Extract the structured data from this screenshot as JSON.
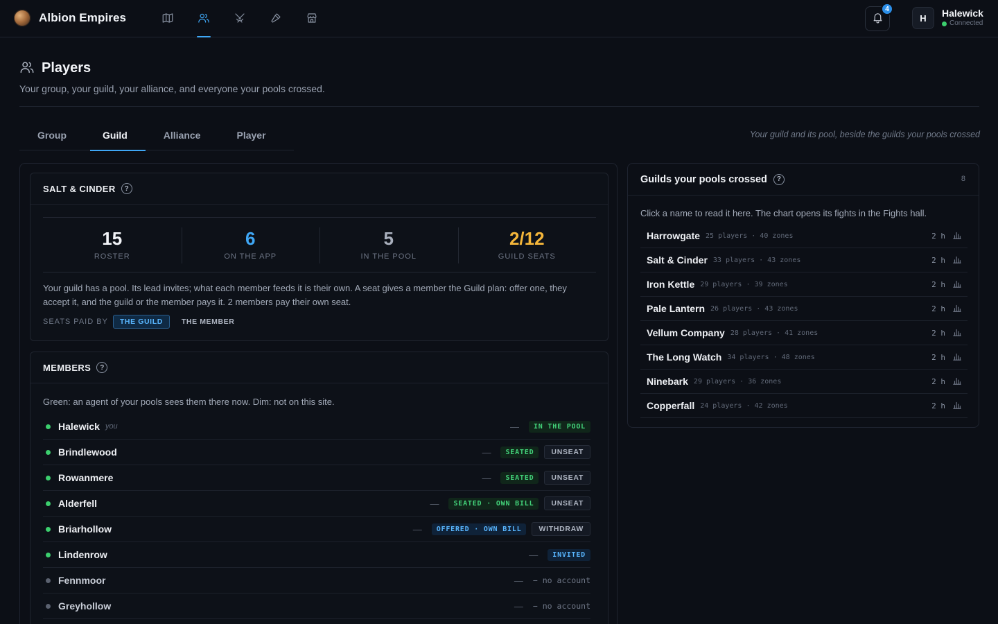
{
  "app": {
    "name": "Albion Empires"
  },
  "nav": {
    "items": [
      {
        "icon": "map-icon",
        "active": false
      },
      {
        "icon": "players-icon",
        "active": true
      },
      {
        "icon": "crossed-swords-icon",
        "active": false
      },
      {
        "icon": "hammer-icon",
        "active": false
      },
      {
        "icon": "market-icon",
        "active": false
      }
    ]
  },
  "notifications": {
    "count": "4"
  },
  "user": {
    "initial": "H",
    "name": "Halewick",
    "status": "Connected"
  },
  "page": {
    "title": "Players",
    "subtitle": "Your group, your guild, your alliance, and everyone your pools crossed."
  },
  "tabs": {
    "items": [
      {
        "label": "Group",
        "active": false
      },
      {
        "label": "Guild",
        "active": true
      },
      {
        "label": "Alliance",
        "active": false
      },
      {
        "label": "Player",
        "active": false
      }
    ],
    "note": "Your guild and its pool, beside the guilds your pools crossed"
  },
  "guild_card": {
    "title": "SALT & CINDER",
    "help": "?",
    "stats": [
      {
        "value": "15",
        "label": "ROSTER",
        "tone": "white"
      },
      {
        "value": "6",
        "label": "ON THE APP",
        "tone": "blue"
      },
      {
        "value": "5",
        "label": "IN THE POOL",
        "tone": "gray"
      },
      {
        "value": "2/12",
        "label": "GUILD SEATS",
        "tone": "amber"
      }
    ],
    "description": "Your guild has a pool. Its lead invites; what each member feeds it is their own. A seat gives a member the Guild plan: offer one, they accept it, and the guild or the member pays it. 2 members pay their own seat.",
    "seats_paid_by_label": "SEATS PAID BY",
    "seats_options": [
      {
        "label": "THE GUILD",
        "selected": true
      },
      {
        "label": "THE MEMBER",
        "selected": false
      }
    ]
  },
  "members_card": {
    "title": "MEMBERS",
    "help": "?",
    "note": "Green: an agent of your pools sees them there now. Dim: not on this site.",
    "members": [
      {
        "name": "Halewick",
        "you": "you",
        "live": true,
        "dash": "—",
        "pill": "IN THE POOL",
        "pill_tone": "green",
        "action": ""
      },
      {
        "name": "Brindlewood",
        "you": "",
        "live": true,
        "dash": "—",
        "pill": "SEATED",
        "pill_tone": "green",
        "action": "UNSEAT"
      },
      {
        "name": "Rowanmere",
        "you": "",
        "live": true,
        "dash": "—",
        "pill": "SEATED",
        "pill_tone": "green",
        "action": "UNSEAT"
      },
      {
        "name": "Alderfell",
        "you": "",
        "live": true,
        "dash": "—",
        "pill": "SEATED · OWN BILL",
        "pill_tone": "green",
        "action": "UNSEAT"
      },
      {
        "name": "Briarhollow",
        "you": "",
        "live": true,
        "dash": "—",
        "pill": "OFFERED · OWN BILL",
        "pill_tone": "blue",
        "action": "WITHDRAW"
      },
      {
        "name": "Lindenrow",
        "you": "",
        "live": true,
        "dash": "—",
        "pill": "INVITED",
        "pill_tone": "blue",
        "action": ""
      },
      {
        "name": "Fennmoor",
        "you": "",
        "live": false,
        "dash": "—",
        "no_account": "− no account"
      },
      {
        "name": "Greyhollow",
        "you": "",
        "live": false,
        "dash": "—",
        "no_account": "− no account"
      }
    ]
  },
  "crossed_guilds": {
    "title": "Guilds your pools crossed",
    "help": "?",
    "count": "8",
    "note": "Click a name to read it here. The chart opens its fights in the Fights hall.",
    "guilds": [
      {
        "name": "Harrowgate",
        "meta": "25 players · 40 zones",
        "time": "2 h"
      },
      {
        "name": "Salt & Cinder",
        "meta": "33 players · 43 zones",
        "time": "2 h"
      },
      {
        "name": "Iron Kettle",
        "meta": "29 players · 39 zones",
        "time": "2 h"
      },
      {
        "name": "Pale Lantern",
        "meta": "26 players · 43 zones",
        "time": "2 h"
      },
      {
        "name": "Vellum Company",
        "meta": "28 players · 41 zones",
        "time": "2 h"
      },
      {
        "name": "The Long Watch",
        "meta": "34 players · 48 zones",
        "time": "2 h"
      },
      {
        "name": "Ninebark",
        "meta": "29 players · 36 zones",
        "time": "2 h"
      },
      {
        "name": "Copperfall",
        "meta": "24 players · 42 zones",
        "time": "2 h"
      }
    ]
  },
  "colors": {
    "accent": "#3fa7f5",
    "live": "#3ccf6e",
    "amber": "#f4b63a",
    "background": "#0c0f16"
  }
}
